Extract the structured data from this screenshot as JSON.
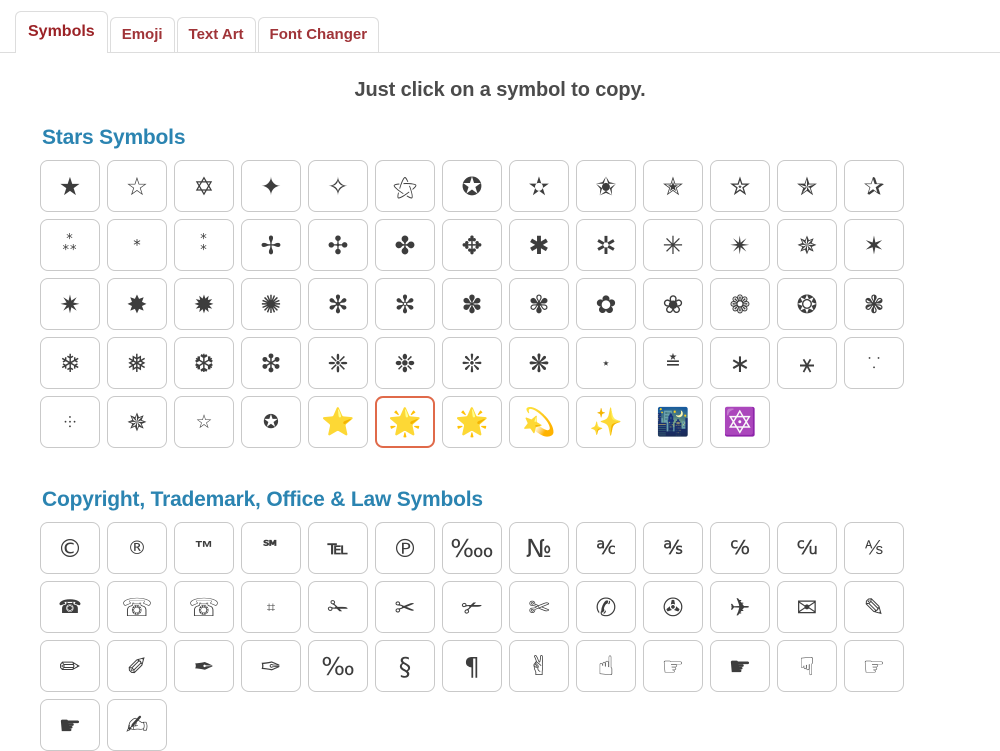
{
  "tabs": [
    {
      "label": "Symbols",
      "active": true
    },
    {
      "label": "Emoji",
      "active": false
    },
    {
      "label": "Text Art",
      "active": false
    },
    {
      "label": "Font Changer",
      "active": false
    }
  ],
  "headline": "Just click on a symbol to copy.",
  "colors": {
    "tab_text": "#9b2226",
    "section_title": "#2b84b1",
    "headline": "#4b4b4b",
    "cell_border": "#c9c9c9",
    "selected_border": "#e06a4a",
    "page_background": "#ffffff"
  },
  "sections": [
    {
      "title": "Stars Symbols",
      "symbols": [
        {
          "char": "★",
          "name": "black-star"
        },
        {
          "char": "☆",
          "name": "white-star"
        },
        {
          "char": "✡",
          "name": "star-of-david"
        },
        {
          "char": "✦",
          "name": "black-four-pointed-star"
        },
        {
          "char": "✧",
          "name": "white-four-pointed-star"
        },
        {
          "char": "⚝",
          "name": "outlined-white-star"
        },
        {
          "char": "✪",
          "name": "circled-white-star"
        },
        {
          "char": "✫",
          "name": "open-centre-black-star"
        },
        {
          "char": "✬",
          "name": "black-centre-white-star"
        },
        {
          "char": "✭",
          "name": "outlined-black-star"
        },
        {
          "char": "✮",
          "name": "heavy-outlined-black-star"
        },
        {
          "char": "✯",
          "name": "pinwheel-star"
        },
        {
          "char": "✰",
          "name": "shadowed-white-star"
        },
        {
          "char": "⁂",
          "name": "asterism",
          "size": "stack",
          "lines": "*\n**"
        },
        {
          "char": "*",
          "name": "asterisk",
          "size": "tiny"
        },
        {
          "char": "⁑",
          "name": "two-asterisks-aligned-vertically",
          "size": "stack",
          "lines": "*\n*"
        },
        {
          "char": "✢",
          "name": "four-teardrop-spoked-asterisk"
        },
        {
          "char": "✣",
          "name": "four-balloon-spoked-asterisk"
        },
        {
          "char": "✤",
          "name": "heavy-four-balloon-spoked-asterisk"
        },
        {
          "char": "✥",
          "name": "four-club-spoked-asterisk"
        },
        {
          "char": "✱",
          "name": "heavy-asterisk"
        },
        {
          "char": "✲",
          "name": "open-centre-asterisk"
        },
        {
          "char": "✳",
          "name": "eight-spoked-asterisk"
        },
        {
          "char": "✴",
          "name": "eight-pointed-black-star"
        },
        {
          "char": "✵",
          "name": "eight-pointed-pinwheel-star"
        },
        {
          "char": "✶",
          "name": "six-pointed-black-star"
        },
        {
          "char": "✷",
          "name": "eight-pointed-rectilinear-black-star"
        },
        {
          "char": "✸",
          "name": "heavy-eight-pointed-rectilinear-black-star"
        },
        {
          "char": "✹",
          "name": "twelve-pointed-black-star"
        },
        {
          "char": "✺",
          "name": "sixteen-pointed-asterisk"
        },
        {
          "char": "✻",
          "name": "teardrop-spoked-asterisk"
        },
        {
          "char": "✼",
          "name": "open-centre-teardrop-spoked-asterisk"
        },
        {
          "char": "✽",
          "name": "heavy-teardrop-spoked-asterisk"
        },
        {
          "char": "✾",
          "name": "six-petalled-black-and-white-florette"
        },
        {
          "char": "✿",
          "name": "black-florette"
        },
        {
          "char": "❀",
          "name": "white-florette"
        },
        {
          "char": "❁",
          "name": "eight-petalled-outlined-black-florette"
        },
        {
          "char": "❂",
          "name": "circled-open-centre-eight-pointed-star"
        },
        {
          "char": "❃",
          "name": "heavy-teardrop-spoked-pinwheel-asterisk"
        },
        {
          "char": "❄",
          "name": "snowflake"
        },
        {
          "char": "❅",
          "name": "tight-trifoliate-snowflake"
        },
        {
          "char": "❆",
          "name": "heavy-chevron-snowflake"
        },
        {
          "char": "❇",
          "name": "sparkle"
        },
        {
          "char": "❈",
          "name": "heavy-sparkle"
        },
        {
          "char": "❉",
          "name": "balloon-spoked-asterisk"
        },
        {
          "char": "❊",
          "name": "eight-teardrop-spoked-propeller-asterisk"
        },
        {
          "char": "❋",
          "name": "heavy-eight-teardrop-spoked-propeller-asterisk"
        },
        {
          "char": "⋆",
          "name": "star-operator",
          "size": "tiny"
        },
        {
          "char": "≛",
          "name": "star-equals",
          "size": "small"
        },
        {
          "char": "∗",
          "name": "asterisk-operator"
        },
        {
          "char": "⚹",
          "name": "sextile"
        },
        {
          "char": "⸪",
          "name": "two-dots-over-one-dot-punctuation",
          "size": "tiny"
        },
        {
          "char": "⸭",
          "name": "five-dot-mark",
          "size": "tiny"
        },
        {
          "char": "✵",
          "name": "eight-pointed-pinwheel-star-outline"
        },
        {
          "char": "☆",
          "name": "white-star-small",
          "size": "small"
        },
        {
          "char": "✪",
          "name": "circled-white-star-2",
          "size": "small"
        },
        {
          "char": "⭐",
          "name": "star-emoji",
          "emoji": true
        },
        {
          "char": "🌟",
          "name": "glowing-star-emoji",
          "emoji": true,
          "selected": true
        },
        {
          "char": "🌟",
          "name": "dizzy-star-emoji",
          "emoji": true
        },
        {
          "char": "💫",
          "name": "dizzy-symbol-emoji",
          "emoji": true
        },
        {
          "char": "✨",
          "name": "sparkles-emoji",
          "emoji": true
        },
        {
          "char": "🌃",
          "name": "night-with-stars-emoji",
          "emoji": true
        },
        {
          "char": "🔯",
          "name": "six-pointed-star-emoji",
          "emoji": true
        }
      ]
    },
    {
      "title": "Copyright, Trademark, Office & Law Symbols",
      "symbols": [
        {
          "char": "©",
          "name": "copyright-sign"
        },
        {
          "char": "®",
          "name": "registered-sign",
          "size": "small"
        },
        {
          "char": "™",
          "name": "trade-mark-sign",
          "size": "txt"
        },
        {
          "char": "℠",
          "name": "service-mark",
          "size": "txt"
        },
        {
          "char": "℡",
          "name": "telephone-sign",
          "size": "txt"
        },
        {
          "char": "℗",
          "name": "sound-recording-copyright"
        },
        {
          "char": "‱",
          "name": "per-ten-thousand-sign"
        },
        {
          "char": "№",
          "name": "numero-sign"
        },
        {
          "char": "℀",
          "name": "account-of",
          "size": "small"
        },
        {
          "char": "℁",
          "name": "addressed-to-the-subject",
          "size": "small"
        },
        {
          "char": "℅",
          "name": "care-of",
          "size": "small"
        },
        {
          "char": "℆",
          "name": "cada-una",
          "size": "small"
        },
        {
          "char": "⅍",
          "name": "aktieselskab",
          "size": "small"
        },
        {
          "char": "☎",
          "name": "headphone-symbol",
          "size": "small"
        },
        {
          "char": "☏",
          "name": "black-telephone"
        },
        {
          "char": "☏",
          "name": "white-telephone"
        },
        {
          "char": "⌗",
          "name": "viewdata-square",
          "size": "tiny"
        },
        {
          "char": "✁",
          "name": "upper-blade-scissors"
        },
        {
          "char": "✂",
          "name": "black-scissors"
        },
        {
          "char": "✃",
          "name": "lower-blade-scissors"
        },
        {
          "char": "✄",
          "name": "white-scissors"
        },
        {
          "char": "✆",
          "name": "telephone-location-sign"
        },
        {
          "char": "✇",
          "name": "tape-drive"
        },
        {
          "char": "✈",
          "name": "airplane"
        },
        {
          "char": "✉",
          "name": "envelope"
        },
        {
          "char": "✎",
          "name": "lower-right-pencil"
        },
        {
          "char": "✏",
          "name": "pencil"
        },
        {
          "char": "✐",
          "name": "upper-right-pencil"
        },
        {
          "char": "✒",
          "name": "black-nib"
        },
        {
          "char": "✑",
          "name": "white-nib"
        },
        {
          "char": "‰",
          "name": "per-mille-sign"
        },
        {
          "char": "§",
          "name": "section-sign"
        },
        {
          "char": "¶",
          "name": "pilcrow-sign"
        },
        {
          "char": "✌",
          "name": "victory-hand-emoji",
          "emoji": true
        },
        {
          "char": "☝",
          "name": "index-pointing-up-emoji",
          "emoji": true
        },
        {
          "char": "☞",
          "name": "white-right-pointing-index"
        },
        {
          "char": "☛",
          "name": "black-right-pointing-index"
        },
        {
          "char": "☟",
          "name": "white-down-pointing-index"
        },
        {
          "char": "☞",
          "name": "white-right-pointing-index-2"
        },
        {
          "char": "☛",
          "name": "black-right-pointing-index-2"
        },
        {
          "char": "✍",
          "name": "writing-hand-emoji",
          "emoji": true
        }
      ]
    }
  ]
}
